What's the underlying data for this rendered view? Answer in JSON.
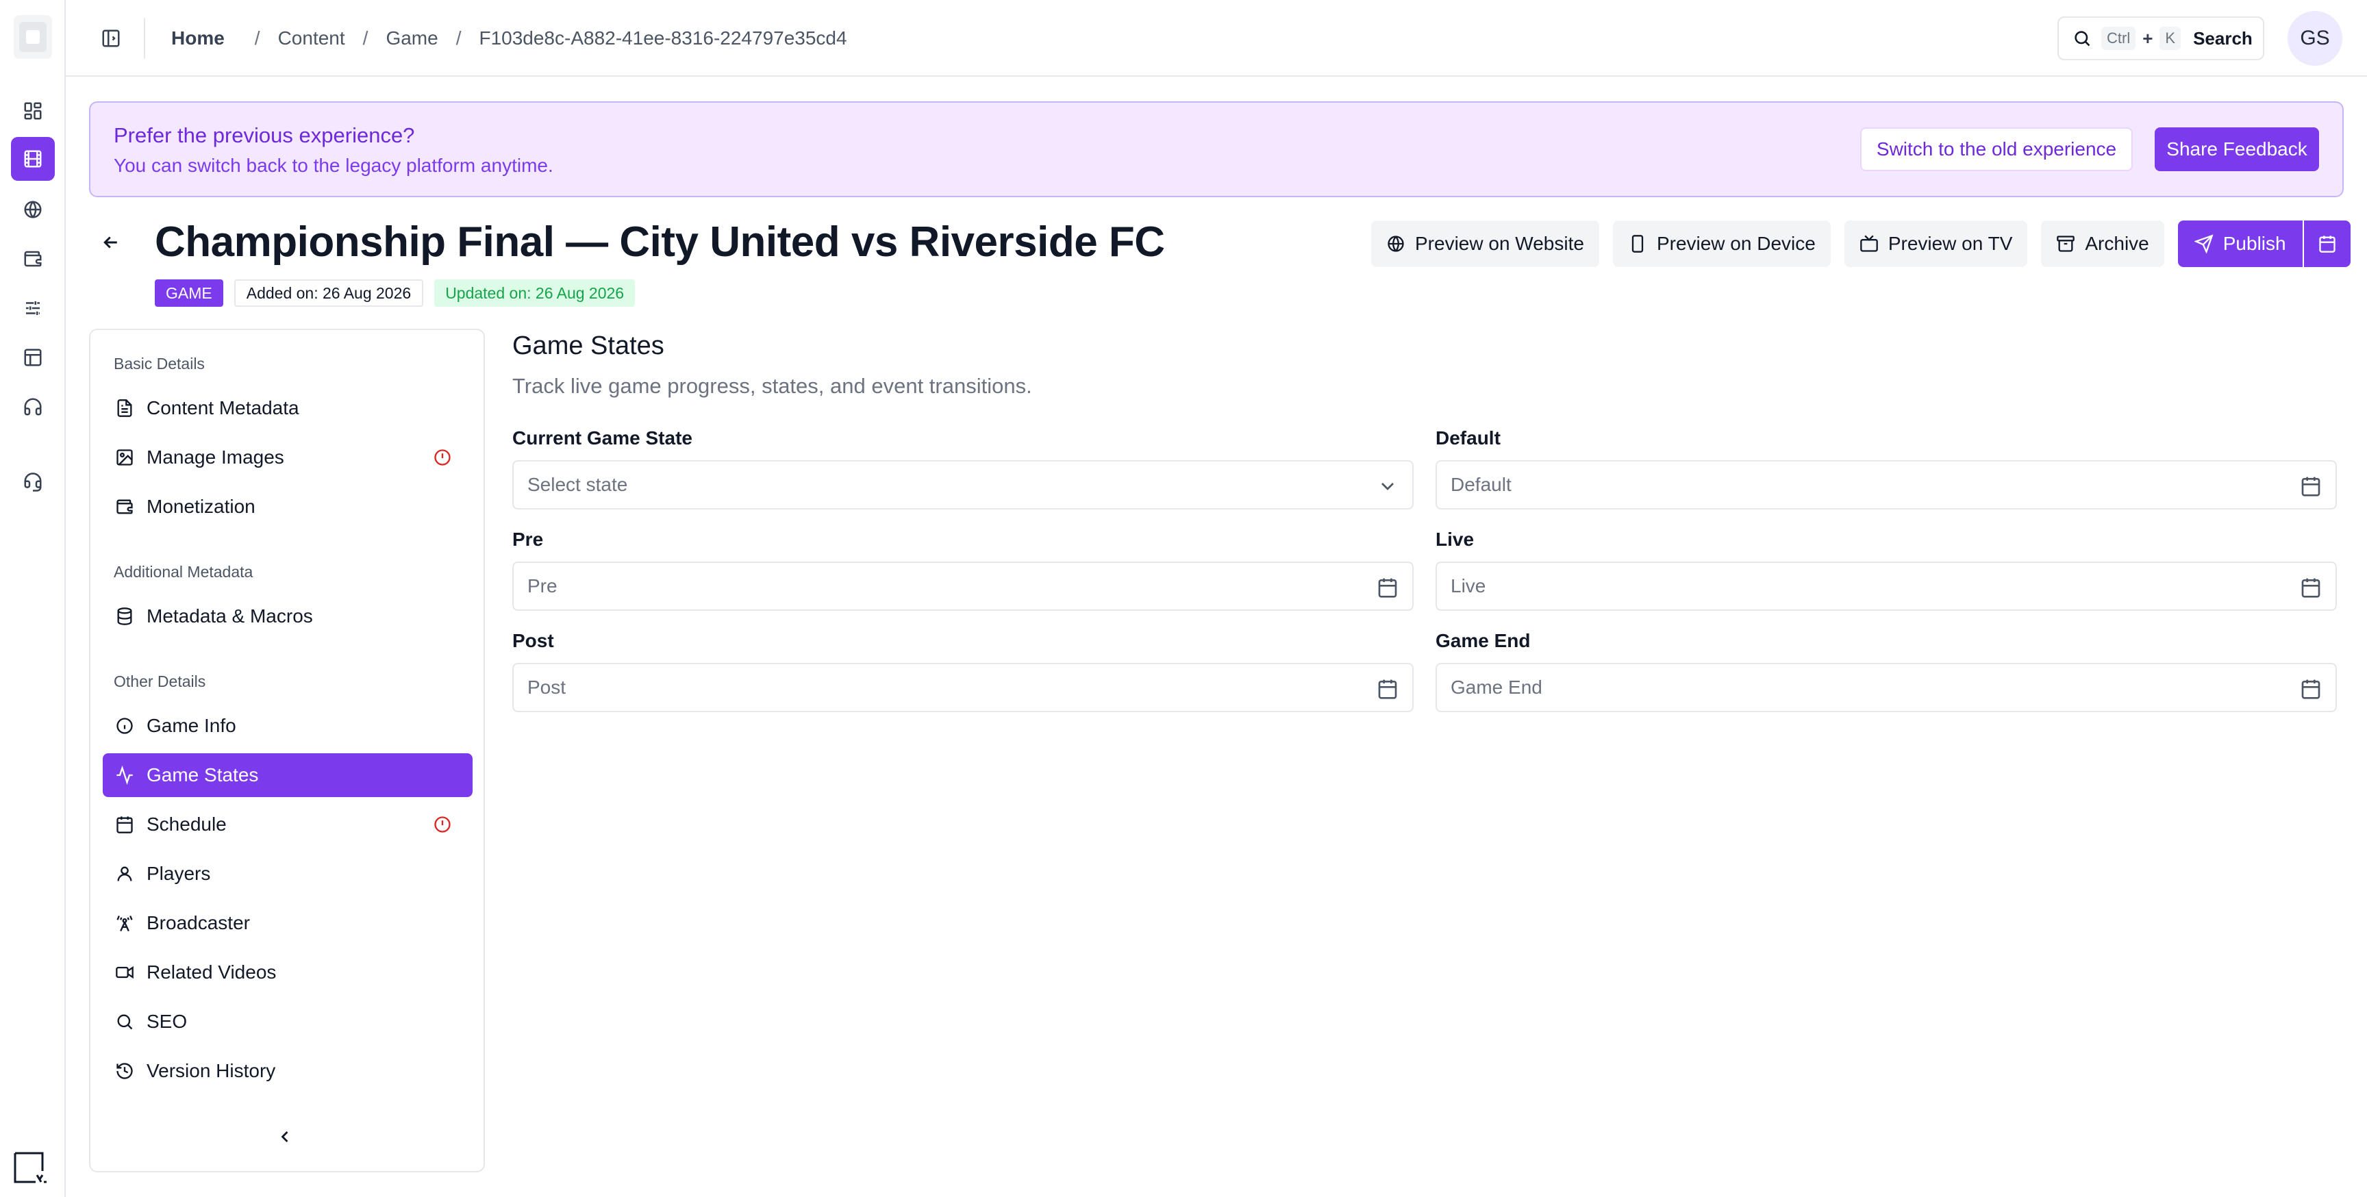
{
  "rail": {
    "items": [
      {
        "name": "dashboard",
        "icon": "dashboard-icon"
      },
      {
        "name": "content",
        "icon": "film-icon",
        "active": true
      },
      {
        "name": "web",
        "icon": "globe-icon"
      },
      {
        "name": "monetization",
        "icon": "wallet-icon"
      },
      {
        "name": "settings",
        "icon": "sliders-icon"
      },
      {
        "name": "layout",
        "icon": "layout-icon"
      },
      {
        "name": "support",
        "icon": "headphones-icon"
      },
      {
        "name": "help",
        "icon": "headset-icon"
      }
    ]
  },
  "topbar": {
    "breadcrumb": {
      "home": "Home",
      "items": [
        "Content",
        "Game",
        "F103de8c-A882-41ee-8316-224797e35cd4"
      ]
    },
    "search": {
      "kbd_ctrl": "Ctrl",
      "plus": "+",
      "kbd_k": "K",
      "label": "Search"
    },
    "avatar": "GS"
  },
  "banner": {
    "title": "Prefer the previous experience?",
    "subtitle": "You can switch back to the legacy platform anytime.",
    "switch_label": "Switch to the old experience",
    "feedback_label": "Share Feedback"
  },
  "header": {
    "title": "Championship Final — City United vs Riverside FC",
    "type_badge": "GAME",
    "added": "Added on: 26 Aug 2026",
    "updated": "Updated on: 26 Aug 2026",
    "actions": {
      "preview_website": "Preview on Website",
      "preview_device": "Preview on Device",
      "preview_tv": "Preview on TV",
      "archive": "Archive",
      "publish": "Publish"
    }
  },
  "nav": {
    "basic_title": "Basic Details",
    "additional_title": "Additional Metadata",
    "other_title": "Other Details",
    "items": {
      "content_metadata": "Content Metadata",
      "manage_images": "Manage Images",
      "monetization": "Monetization",
      "metadata_macros": "Metadata & Macros",
      "game_info": "Game Info",
      "game_states": "Game States",
      "schedule": "Schedule",
      "players": "Players",
      "broadcaster": "Broadcaster",
      "related_videos": "Related Videos",
      "seo": "SEO",
      "version_history": "Version History"
    },
    "active": "game_states",
    "accent": "#7c3aed",
    "alert_color": "#dc2626"
  },
  "main": {
    "title": "Game States",
    "description": "Track live game progress, states, and event transitions.",
    "fields": {
      "current_state": {
        "label": "Current Game State",
        "placeholder": "Select state"
      },
      "default": {
        "label": "Default",
        "placeholder": "Default"
      },
      "pre": {
        "label": "Pre",
        "placeholder": "Pre"
      },
      "live": {
        "label": "Live",
        "placeholder": "Live"
      },
      "post": {
        "label": "Post",
        "placeholder": "Post"
      },
      "game_end": {
        "label": "Game End",
        "placeholder": "Game End"
      }
    }
  }
}
